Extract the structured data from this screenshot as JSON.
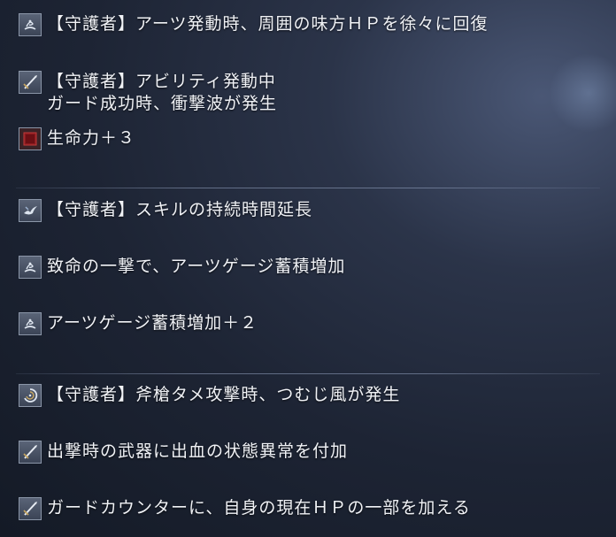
{
  "skills": [
    {
      "icon": "wave-emblem-icon",
      "lines": [
        "【守護者】アーツ発動時、周囲の味方ＨＰを徐々に回復"
      ]
    },
    {
      "icon": "sword-icon",
      "lines": [
        "【守護者】アビリティ発動中",
        "ガード成功時、衝撃波が発生"
      ]
    },
    {
      "icon": "vitality-icon",
      "lines": [
        "生命力＋３"
      ]
    },
    {
      "icon": "bird-icon",
      "lines": [
        "【守護者】スキルの持続時間延長"
      ]
    },
    {
      "icon": "wave-emblem-icon",
      "lines": [
        "致命の一撃で、アーツゲージ蓄積増加"
      ]
    },
    {
      "icon": "wave-emblem-icon",
      "lines": [
        "アーツゲージ蓄積増加＋２"
      ]
    },
    {
      "icon": "whirlwind-icon",
      "lines": [
        "【守護者】斧槍タメ攻撃時、つむじ風が発生"
      ]
    },
    {
      "icon": "sword-icon",
      "lines": [
        "出撃時の武器に出血の状態異常を付加"
      ]
    },
    {
      "icon": "sword-icon",
      "lines": [
        "ガードカウンターに、自身の現在ＨＰの一部を加える"
      ]
    }
  ]
}
